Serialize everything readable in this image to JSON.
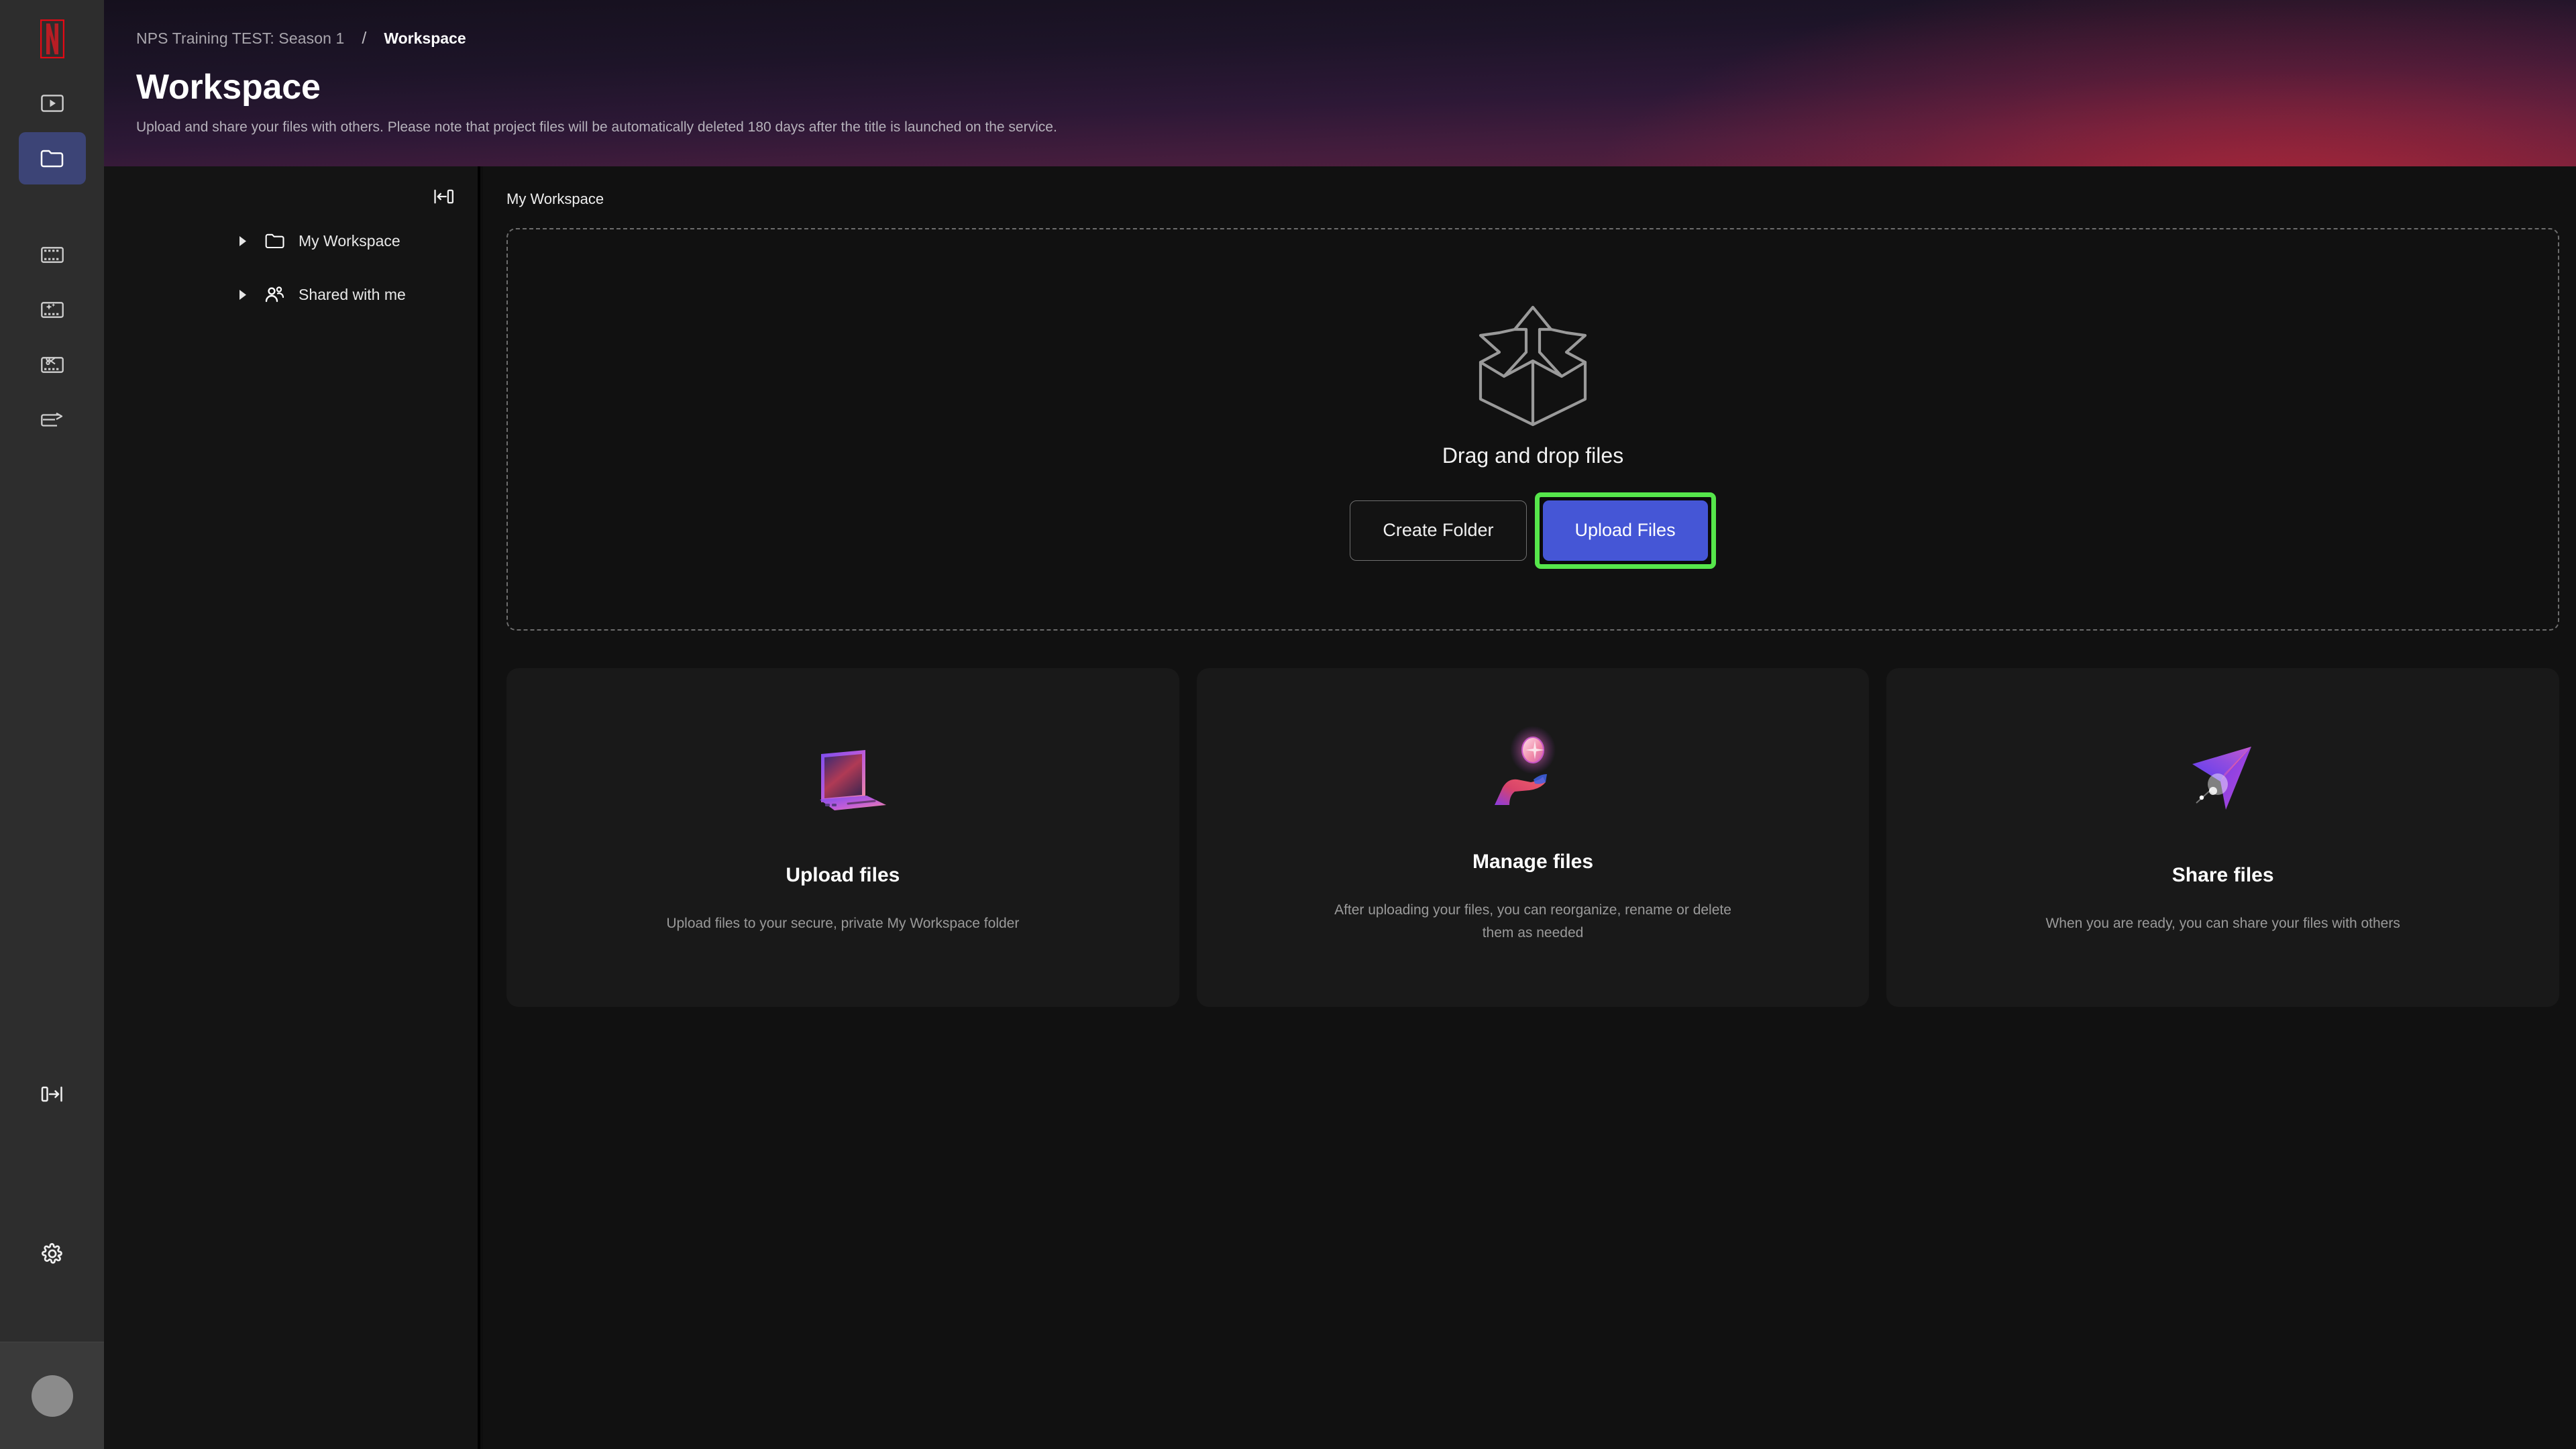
{
  "brand": {
    "logo_icon": "netflix-n-logo",
    "logo_color": "#e50914"
  },
  "rail": {
    "items": [
      {
        "id": "player",
        "icon": "video-player-icon",
        "active": false
      },
      {
        "id": "workspace",
        "icon": "folder-icon",
        "active": true
      },
      {
        "id": "assets",
        "icon": "film-strip-icon",
        "active": false
      },
      {
        "id": "vfx",
        "icon": "film-sparkle-icon",
        "active": false
      },
      {
        "id": "editorial",
        "icon": "film-scissors-icon",
        "active": false
      },
      {
        "id": "delivery",
        "icon": "film-arrow-icon",
        "active": false
      }
    ],
    "expand_icon": "panel-expand-right-icon",
    "settings_icon": "gear-icon",
    "avatar_icon": "user-avatar"
  },
  "header": {
    "breadcrumb_root": "NPS Training TEST: Season 1",
    "breadcrumb_separator": "/",
    "breadcrumb_current": "Workspace",
    "title": "Workspace",
    "subtitle": "Upload and share your files with others. Please note that project files will be automatically deleted 180 days after the title is launched on the service."
  },
  "sidebar": {
    "collapse_icon": "panel-collapse-left-icon",
    "items": [
      {
        "label": "My Workspace",
        "icon": "folder-icon",
        "caret": "caret-right-icon"
      },
      {
        "label": "Shared with me",
        "icon": "people-icon",
        "caret": "caret-right-icon"
      }
    ]
  },
  "main": {
    "section_title": "My Workspace",
    "dropzone": {
      "art_icon": "open-box-upload-icon",
      "text": "Drag and drop files",
      "create_folder_label": "Create Folder",
      "upload_files_label": "Upload Files",
      "highlight_color": "#56e64b",
      "primary_color": "#4556d6"
    },
    "cards": [
      {
        "art_icon": "laptop-icon",
        "title": "Upload files",
        "desc": "Upload files to your secure, private My Workspace folder"
      },
      {
        "art_icon": "hand-orb-icon",
        "title": "Manage files",
        "desc": "After uploading your files, you can reorganize, rename or delete them as needed"
      },
      {
        "art_icon": "paper-plane-icon",
        "title": "Share files",
        "desc": "When you are ready, you can share your files with others"
      }
    ]
  }
}
